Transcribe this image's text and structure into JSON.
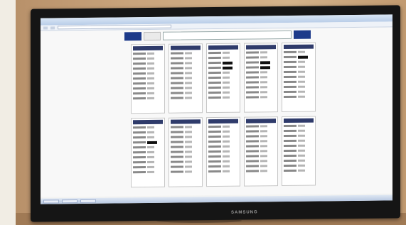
{
  "photo": {
    "monitor_brand": "SAMSUNG"
  },
  "browser": {
    "title_text": "",
    "address_text": ""
  },
  "page": {
    "banner_title": "",
    "banner_small_text": ""
  },
  "taskbar": {
    "clock": ""
  },
  "colors": {
    "banner_blue": "#1d3a8a",
    "panel_header": "#2f3b6b",
    "screen_bg": "#f4f4f2",
    "bezel": "#151515"
  },
  "panels": [
    {
      "rows": [
        "n",
        "n",
        "n",
        "n",
        "n",
        "n",
        "n",
        "n",
        "n",
        "n"
      ]
    },
    {
      "rows": [
        "n",
        "n",
        "n",
        "n",
        "n",
        "n",
        "n",
        "n",
        "n",
        "n"
      ]
    },
    {
      "rows": [
        "n",
        "n",
        "hi",
        "hi",
        "n",
        "n",
        "n",
        "n",
        "n",
        "n"
      ]
    },
    {
      "rows": [
        "n",
        "n",
        "hi",
        "hi",
        "n",
        "n",
        "n",
        "n",
        "n",
        "n"
      ]
    },
    {
      "rows": [
        "n",
        "hi",
        "n",
        "n",
        "n",
        "n",
        "n",
        "n",
        "n",
        "n"
      ]
    },
    {
      "rows": [
        "n",
        "n",
        "n",
        "hi",
        "n",
        "n",
        "n",
        "n",
        "n",
        "n"
      ]
    },
    {
      "rows": [
        "n",
        "n",
        "n",
        "n",
        "n",
        "n",
        "n",
        "n",
        "n",
        "n"
      ]
    },
    {
      "rows": [
        "n",
        "n",
        "n",
        "n",
        "n",
        "n",
        "n",
        "n",
        "n",
        "n"
      ]
    },
    {
      "rows": [
        "n",
        "n",
        "n",
        "n",
        "n",
        "n",
        "n",
        "n",
        "n",
        "n"
      ]
    },
    {
      "rows": [
        "n",
        "n",
        "n",
        "n",
        "n",
        "n",
        "n",
        "n",
        "n",
        "n"
      ]
    }
  ]
}
